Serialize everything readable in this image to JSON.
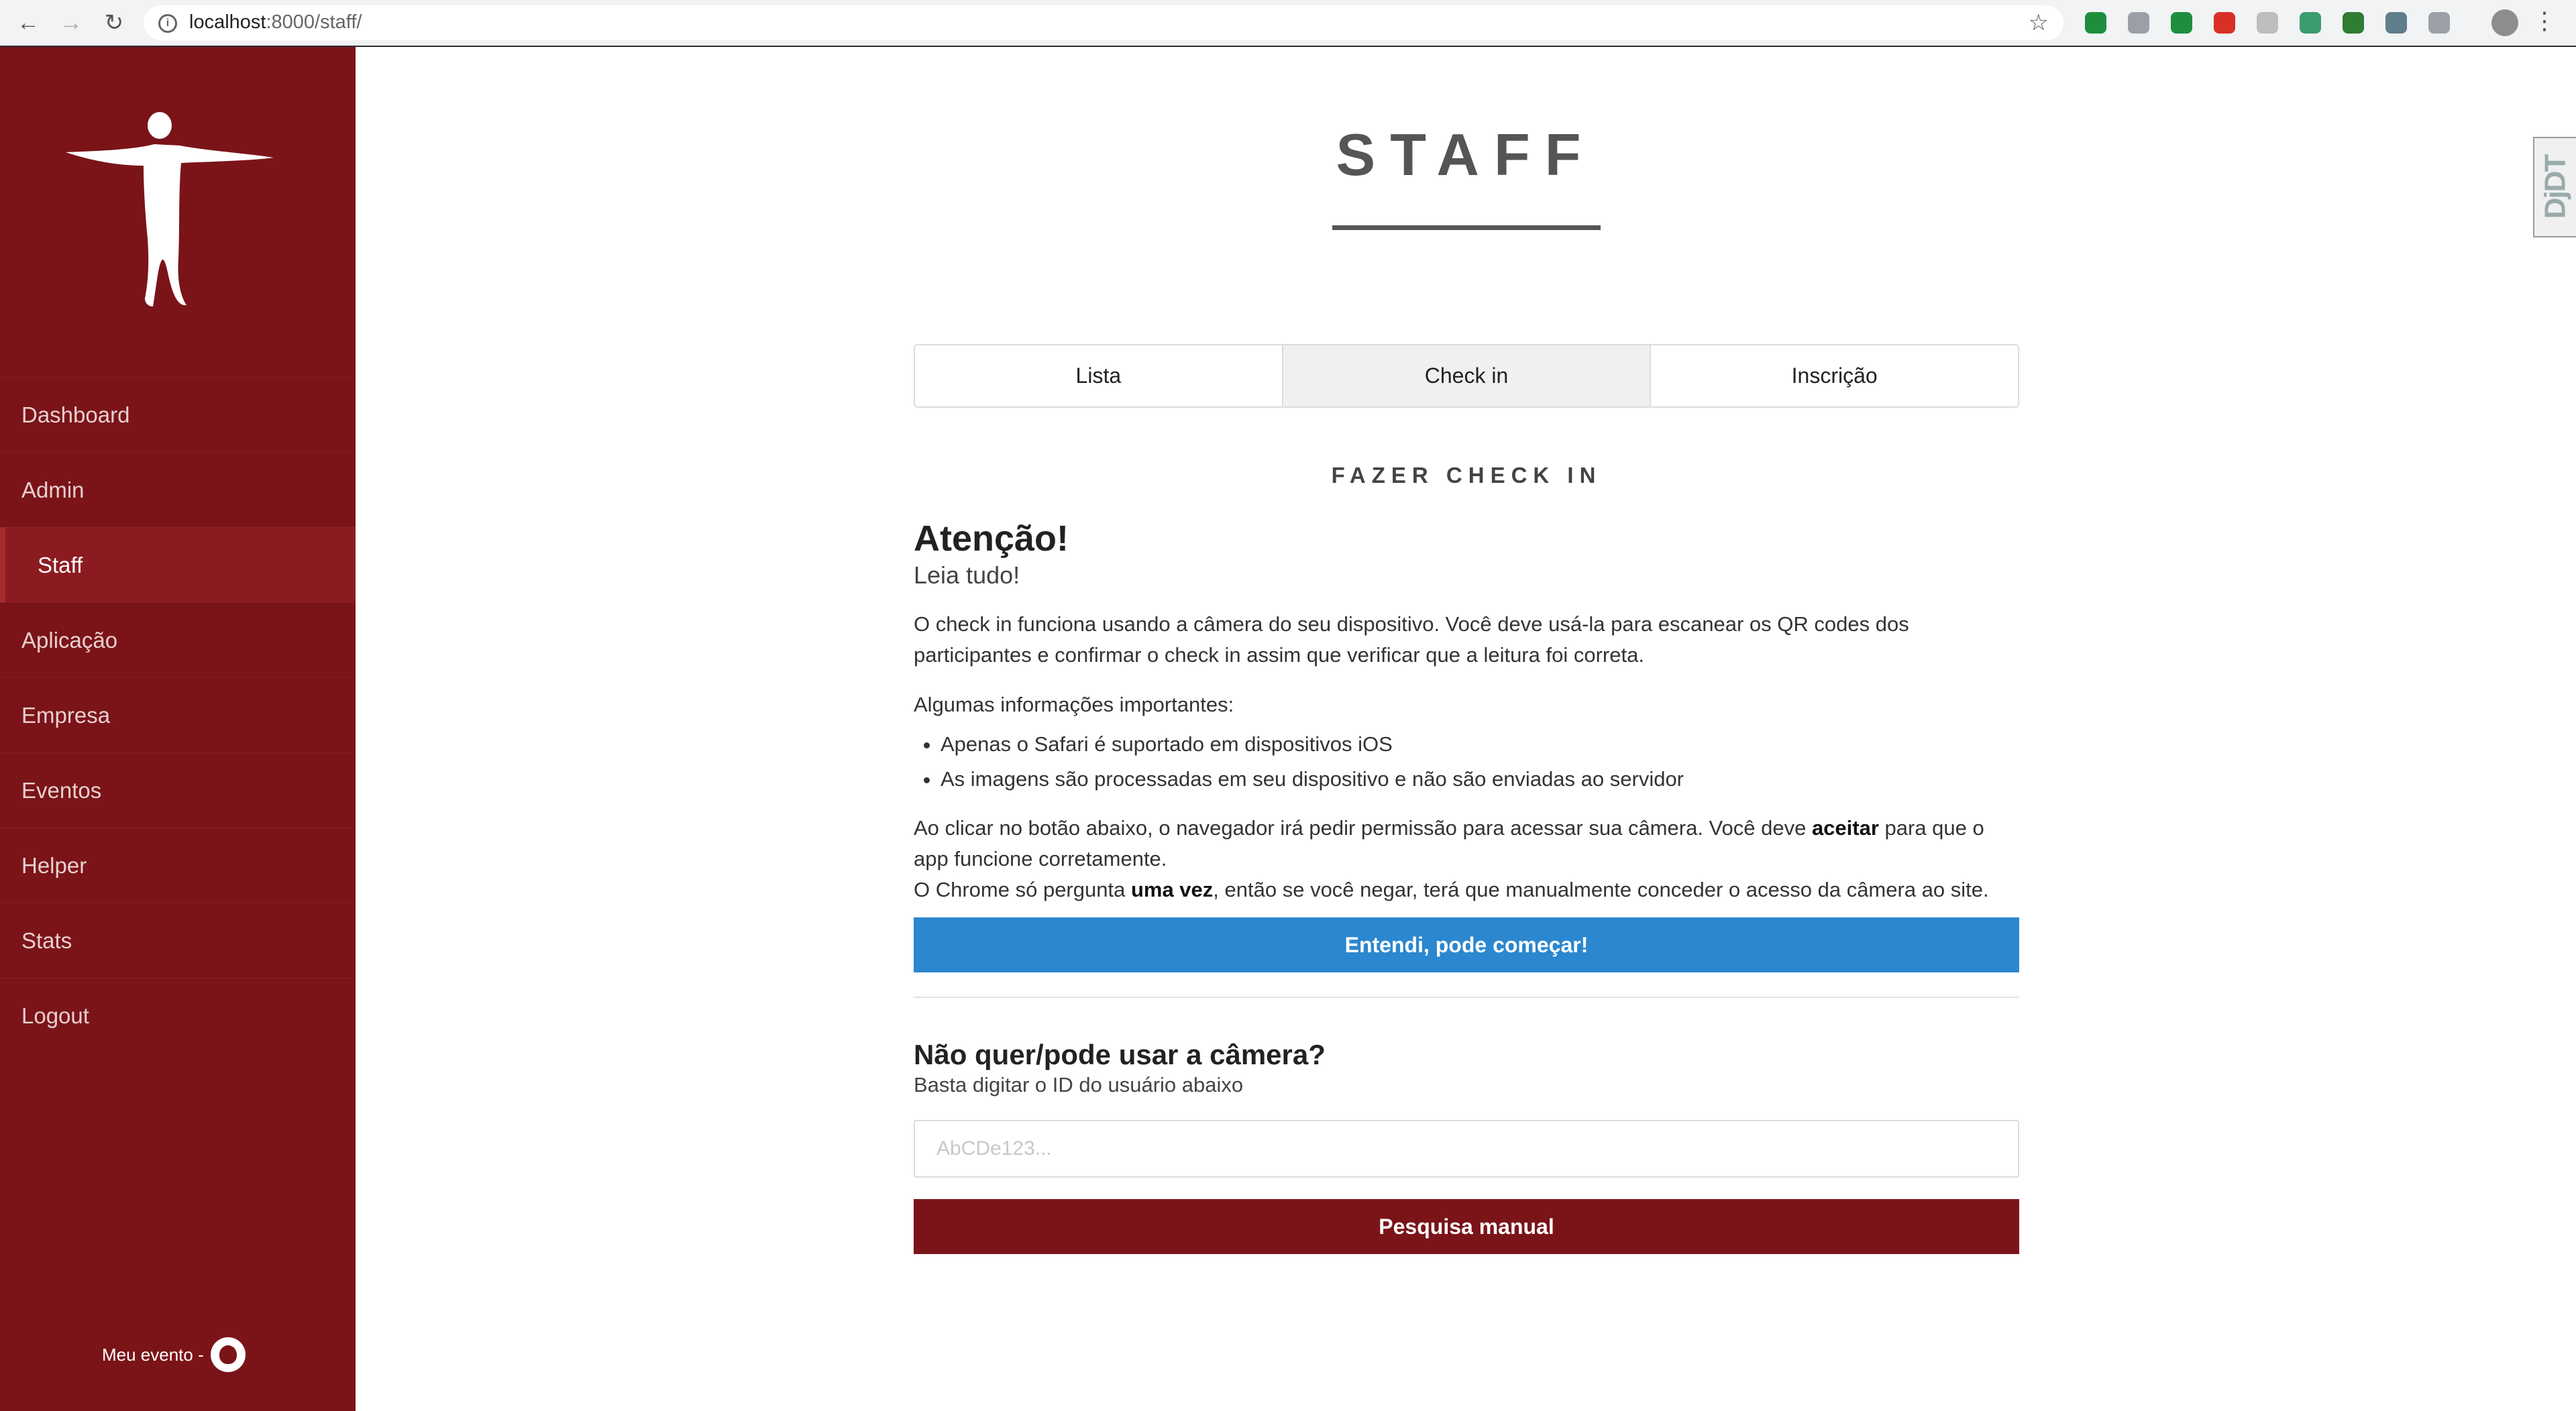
{
  "browser": {
    "url_host": "localhost",
    "url_path": ":8000/staff/",
    "ext_colors": [
      "#1e8e3e",
      "#9aa0a6",
      "#1e8e3e",
      "#d93025",
      "#bdbdbd",
      "#3c9c6e",
      "#2e7d32",
      "#607d8b",
      "#9aa0a6"
    ]
  },
  "sidebar": {
    "items": [
      {
        "label": "Dashboard",
        "active": false
      },
      {
        "label": "Admin",
        "active": false
      },
      {
        "label": "Staff",
        "active": true
      },
      {
        "label": "Aplicação",
        "active": false
      },
      {
        "label": "Empresa",
        "active": false
      },
      {
        "label": "Eventos",
        "active": false
      },
      {
        "label": "Helper",
        "active": false
      },
      {
        "label": "Stats",
        "active": false
      },
      {
        "label": "Logout",
        "active": false
      }
    ],
    "footer_label": "Meu evento -",
    "footer_icon": "github-icon"
  },
  "main": {
    "title": "STAFF",
    "tabs": [
      {
        "label": "Lista",
        "active": false
      },
      {
        "label": "Check in",
        "active": true
      },
      {
        "label": "Inscrição",
        "active": false
      }
    ],
    "section_heading": "FAZER CHECK IN",
    "attention_title": "Atenção!",
    "attention_subtitle": "Leia tudo!",
    "paragraph_1": "O check in funciona usando a câmera do seu dispositivo. Você deve usá-la para escanear os QR codes dos participantes e confirmar o check in assim que verificar que a leitura foi correta.",
    "important_label": "Algumas informações importantes:",
    "bullets": [
      "Apenas o Safari é suportado em dispositivos iOS",
      "As imagens são processadas em seu dispositivo e não são enviadas ao servidor"
    ],
    "permission_text_1": "Ao clicar no botão abaixo, o navegador irá pedir permissão para acessar sua câmera. Você deve ",
    "permission_bold": "aceitar",
    "permission_text_2": " para que o app funcione corretamente.",
    "chrome_text_1": "O Chrome só pergunta ",
    "chrome_bold": "uma vez",
    "chrome_text_2": ", então se você negar, terá que manualmente conceder o acesso da câmera ao site.",
    "start_button": "Entendi, pode começar!",
    "manual_title": "Não quer/pode usar a câmera?",
    "manual_subtitle": "Basta digitar o ID do usuário abaixo",
    "id_input": {
      "value": "",
      "placeholder": "AbCDe123..."
    },
    "manual_button": "Pesquisa manual"
  },
  "debug_toolbar": {
    "label": "DjDT"
  },
  "colors": {
    "sidebar_bg": "#7a1418",
    "primary_button": "#2b87cf",
    "danger_button": "#7a1418"
  }
}
